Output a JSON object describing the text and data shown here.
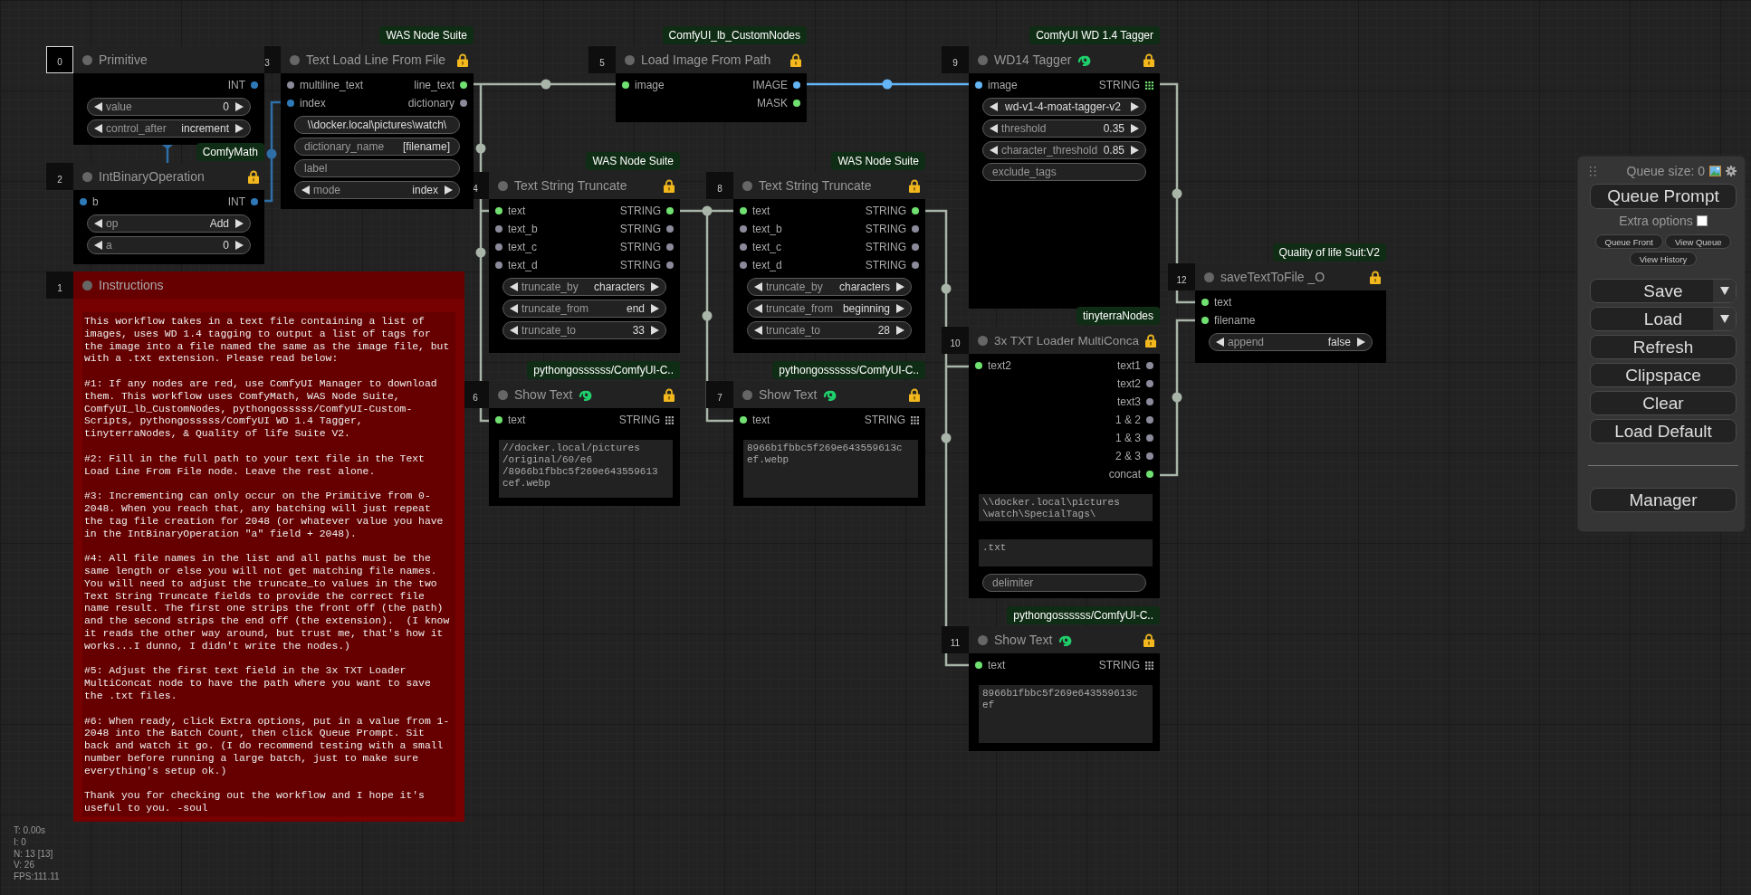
{
  "nodes": [
    {
      "id": "0",
      "title": "Primitive",
      "kind": "node",
      "color": "#222222",
      "selected": true,
      "locked": false,
      "logo": false,
      "slots": [
        {
          "output": {
            "label": "INT",
            "color": "#2e7ab8",
            "kind": "dot"
          }
        }
      ],
      "widgets": [
        {
          "kind": "combo",
          "label": "value",
          "value": "0"
        },
        {
          "kind": "combo",
          "label": "control_after",
          "value": "increment"
        }
      ]
    },
    {
      "id": "3",
      "title": "Text Load Line From File",
      "badge": "WAS Node Suite",
      "kind": "node",
      "color": "#222222",
      "selected": false,
      "locked": true,
      "logo": false,
      "slots": [
        {
          "input": {
            "label": "multiline_text",
            "color": "#8a8a9a"
          },
          "output": {
            "label": "line_text",
            "color": "#70e070",
            "kind": "dot"
          }
        },
        {
          "input": {
            "label": "index",
            "color": "#2e7ab8"
          },
          "output": {
            "label": "dictionary",
            "color": "#8a8a9a",
            "kind": "dot"
          }
        }
      ],
      "widgets": [
        {
          "kind": "text",
          "value": "\\\\docker.local\\pictures\\watch\\"
        },
        {
          "kind": "text",
          "label": "dictionary_name",
          "value": "[filename]"
        },
        {
          "kind": "text",
          "label": "label"
        },
        {
          "kind": "combo",
          "label": "mode",
          "value": "index"
        }
      ]
    },
    {
      "id": "5",
      "title": "Load Image From Path",
      "badge": "ComfyUI_lb_CustomNodes",
      "kind": "node",
      "color": "#222222",
      "selected": false,
      "locked": true,
      "logo": false,
      "slots": [
        {
          "input": {
            "label": "image",
            "color": "#70e070"
          },
          "output": {
            "label": "IMAGE",
            "color": "#64b5f6",
            "kind": "dot"
          }
        },
        {
          "output": {
            "label": "MASK",
            "color": "#70e070",
            "kind": "dot"
          }
        }
      ]
    },
    {
      "id": "9",
      "title": "WD14 Tagger",
      "badge": "ComfyUI WD 1.4 Tagger",
      "kind": "node",
      "color": "#222222",
      "selected": false,
      "locked": true,
      "logo": true,
      "slots": [
        {
          "input": {
            "label": "image",
            "color": "#64b5f6"
          },
          "output": {
            "label": "STRING",
            "color": "#70e070",
            "kind": "grid"
          }
        }
      ],
      "widgets": [
        {
          "kind": "combo",
          "value": "wd-v1-4-moat-tagger-v2"
        },
        {
          "kind": "combo",
          "label": "threshold",
          "value": "0.35"
        },
        {
          "kind": "combo",
          "label": "character_threshold",
          "value": "0.85"
        },
        {
          "kind": "text",
          "label": "exclude_tags"
        }
      ]
    },
    {
      "id": "2",
      "title": "IntBinaryOperation",
      "badge": "ComfyMath",
      "kind": "node",
      "color": "#222222",
      "selected": false,
      "locked": true,
      "logo": false,
      "slots": [
        {
          "input": {
            "label": "b",
            "color": "#2e7ab8"
          },
          "output": {
            "label": "INT",
            "color": "#2e7ab8",
            "kind": "dot"
          }
        }
      ],
      "widgets": [
        {
          "kind": "combo",
          "label": "op",
          "value": "Add"
        },
        {
          "kind": "combo",
          "label": "a",
          "value": "0"
        }
      ]
    },
    {
      "id": "4",
      "title": "Text String Truncate",
      "badge": "WAS Node Suite",
      "kind": "node",
      "color": "#222222",
      "selected": false,
      "locked": true,
      "logo": false,
      "slots": [
        {
          "input": {
            "label": "text",
            "color": "#70e070"
          },
          "output": {
            "label": "STRING",
            "color": "#70e070",
            "kind": "dot"
          }
        },
        {
          "input": {
            "label": "text_b",
            "color": "#8a8a9a"
          },
          "output": {
            "label": "STRING",
            "color": "#8a8a9a",
            "kind": "dot"
          }
        },
        {
          "input": {
            "label": "text_c",
            "color": "#8a8a9a"
          },
          "output": {
            "label": "STRING",
            "color": "#8a8a9a",
            "kind": "dot"
          }
        },
        {
          "input": {
            "label": "text_d",
            "color": "#8a8a9a"
          },
          "output": {
            "label": "STRING",
            "color": "#8a8a9a",
            "kind": "dot"
          }
        }
      ],
      "widgets": [
        {
          "kind": "combo",
          "label": "truncate_by",
          "value": "characters"
        },
        {
          "kind": "combo",
          "label": "truncate_from",
          "value": "end"
        },
        {
          "kind": "combo",
          "label": "truncate_to",
          "value": "33"
        }
      ]
    },
    {
      "id": "8",
      "title": "Text String Truncate",
      "badge": "WAS Node Suite",
      "kind": "node",
      "color": "#222222",
      "selected": false,
      "locked": true,
      "logo": false,
      "slots": [
        {
          "input": {
            "label": "text",
            "color": "#70e070"
          },
          "output": {
            "label": "STRING",
            "color": "#70e070",
            "kind": "dot"
          }
        },
        {
          "input": {
            "label": "text_b",
            "color": "#8a8a9a"
          },
          "output": {
            "label": "STRING",
            "color": "#8a8a9a",
            "kind": "dot"
          }
        },
        {
          "input": {
            "label": "text_c",
            "color": "#8a8a9a"
          },
          "output": {
            "label": "STRING",
            "color": "#8a8a9a",
            "kind": "dot"
          }
        },
        {
          "input": {
            "label": "text_d",
            "color": "#8a8a9a"
          },
          "output": {
            "label": "STRING",
            "color": "#8a8a9a",
            "kind": "dot"
          }
        }
      ],
      "widgets": [
        {
          "kind": "combo",
          "label": "truncate_by",
          "value": "characters"
        },
        {
          "kind": "combo",
          "label": "truncate_from",
          "value": "beginning"
        },
        {
          "kind": "combo",
          "label": "truncate_to",
          "value": "28"
        }
      ]
    },
    {
      "id": "12",
      "title": "saveTextToFile _O",
      "badge": "Quality of life Suit:V2",
      "kind": "node",
      "color": "#222222",
      "selected": false,
      "locked": true,
      "logo": false,
      "slots": [
        {
          "input": {
            "label": "text",
            "color": "#70e070"
          }
        },
        {
          "input": {
            "label": "filename",
            "color": "#70e070"
          }
        }
      ],
      "widgets": [
        {
          "kind": "combo",
          "label": "append",
          "value": "false"
        }
      ]
    },
    {
      "id": "1",
      "title": "Instructions",
      "kind": "note",
      "color": "#660000",
      "selected": false,
      "locked": false,
      "logo": false,
      "widgets": [
        {
          "kind": "textarea",
          "value": "This workflow takes in a text file containing a list of images, uses WD 1.4 tagging to output a list of tags for the image into a file named the same as the image file, but with a .txt extension. Please read below:\n\n#1: If any nodes are red, use ComfyUI Manager to download them. This workflow uses ComfyMath, WAS Node Suite, ComfyUI_lb_CustomNodes, pythongosssss/ComfyUI-Custom-Scripts, pythongosssss/ComfyUI WD 1.4 Tagger, tinyterraNodes, & Quality of life Suite V2.\n\n#2: Fill in the full path to your text file in the Text Load Line From File node. Leave the rest alone.\n\n#3: Incrementing can only occur on the Primitive from 0-2048. When you reach that, any batching will just repeat the tag file creation for 2048 (or whatever value you have in the IntBinaryOperation \"a\" field + 2048).\n\n#4: All file names in the list and all paths must be the same length or else you will not get matching file names. You will need to adjust the truncate_to values in the two Text String Truncate fields to provide the correct file name result. The first one strips the front off (the path) and the second strips the end off (the extension).  (I know it reads the other way around, but trust me, that's how it works...I dunno, I didn't write the nodes.)\n\n#5: Adjust the first text field in the 3x TXT Loader MultiConcat node to have the path where you want to save the .txt files.\n\n#6: When ready, click Extra options, put in a value from 1-2048 into the Batch Count, then click Queue Prompt. Sit back and watch it go. (I do recommend testing with a small number before running a large batch, just to make sure everything's setup ok.)\n\nThank you for checking out the workflow and I hope it's useful to you. -soul"
        }
      ]
    },
    {
      "id": "10",
      "title": "3x TXT Loader MultiConca",
      "badge": "tinyterraNodes",
      "kind": "node",
      "color": "#222222",
      "selected": false,
      "locked": true,
      "logo": false,
      "slots": [
        {
          "input": {
            "label": "text2",
            "color": "#70e070"
          },
          "output": {
            "label": "text1",
            "color": "#8a8a9a",
            "kind": "dot"
          }
        },
        {
          "output": {
            "label": "text2",
            "color": "#8a8a9a",
            "kind": "dot"
          }
        },
        {
          "output": {
            "label": "text3",
            "color": "#8a8a9a",
            "kind": "dot"
          }
        },
        {
          "output": {
            "label": "1 & 2",
            "color": "#8a8a9a",
            "kind": "dot"
          }
        },
        {
          "output": {
            "label": "1 & 3",
            "color": "#8a8a9a",
            "kind": "dot"
          }
        },
        {
          "output": {
            "label": "2 & 3",
            "color": "#8a8a9a",
            "kind": "dot"
          }
        },
        {
          "output": {
            "label": "concat",
            "color": "#70e070",
            "kind": "dot"
          }
        }
      ],
      "widgets": [
        {
          "kind": "textarea",
          "value": "\\\\docker.local\\pictures\n\\watch\\SpecialTags\\"
        },
        {
          "kind": "textarea",
          "value": ".txt"
        },
        {
          "kind": "text",
          "label": "delimiter"
        }
      ]
    },
    {
      "id": "6",
      "title": "Show Text",
      "badge": "pythongossssss/ComfyUI-C..",
      "kind": "node",
      "color": "#222222",
      "selected": false,
      "locked": true,
      "logo": true,
      "slots": [
        {
          "input": {
            "label": "text",
            "color": "#70e070"
          },
          "output": {
            "label": "STRING",
            "color": "#aaaaaa",
            "kind": "grid"
          }
        }
      ],
      "widgets": [
        {
          "kind": "textarea",
          "value": "//docker.local/pictures\n/original/60/e6\n/8966b1fbbc5f269e643559613\ncef.webp"
        }
      ]
    },
    {
      "id": "7",
      "title": "Show Text",
      "badge": "pythongossssss/ComfyUI-C..",
      "kind": "node",
      "color": "#222222",
      "selected": false,
      "locked": true,
      "logo": true,
      "slots": [
        {
          "input": {
            "label": "text",
            "color": "#70e070"
          },
          "output": {
            "label": "STRING",
            "color": "#aaaaaa",
            "kind": "grid"
          }
        }
      ],
      "widgets": [
        {
          "kind": "textarea",
          "value": "8966b1fbbc5f269e643559613c\nef.webp"
        }
      ]
    },
    {
      "id": "11",
      "title": "Show Text",
      "badge": "pythongossssss/ComfyUI-C..",
      "kind": "node",
      "color": "#222222",
      "selected": false,
      "locked": true,
      "logo": true,
      "slots": [
        {
          "input": {
            "label": "text",
            "color": "#70e070"
          },
          "output": {
            "label": "STRING",
            "color": "#aaaaaa",
            "kind": "grid"
          }
        }
      ],
      "widgets": [
        {
          "kind": "textarea",
          "value": "8966b1fbbc5f269e643559613c\nef"
        }
      ]
    }
  ],
  "queue_panel": {
    "queue_size": "Queue size: 0",
    "primary_button": "Queue Prompt",
    "extra_options": {
      "label": "Extra options",
      "checked": false
    },
    "small_buttons": [
      "Queue Front",
      "View Queue",
      "View History"
    ],
    "menu_buttons": [
      {
        "label": "Save",
        "dropdown": true
      },
      {
        "label": "Load",
        "dropdown": true
      },
      {
        "label": "Refresh",
        "dropdown": false
      },
      {
        "label": "Clipspace",
        "dropdown": false
      },
      {
        "label": "Clear",
        "dropdown": false
      },
      {
        "label": "Load Default",
        "dropdown": false
      }
    ],
    "footer_buttons": [
      "Manager"
    ]
  },
  "stats": [
    "T: 0.00s",
    "I: 0",
    "N: 13 [13]",
    "V: 26",
    "FPS:111.11"
  ]
}
